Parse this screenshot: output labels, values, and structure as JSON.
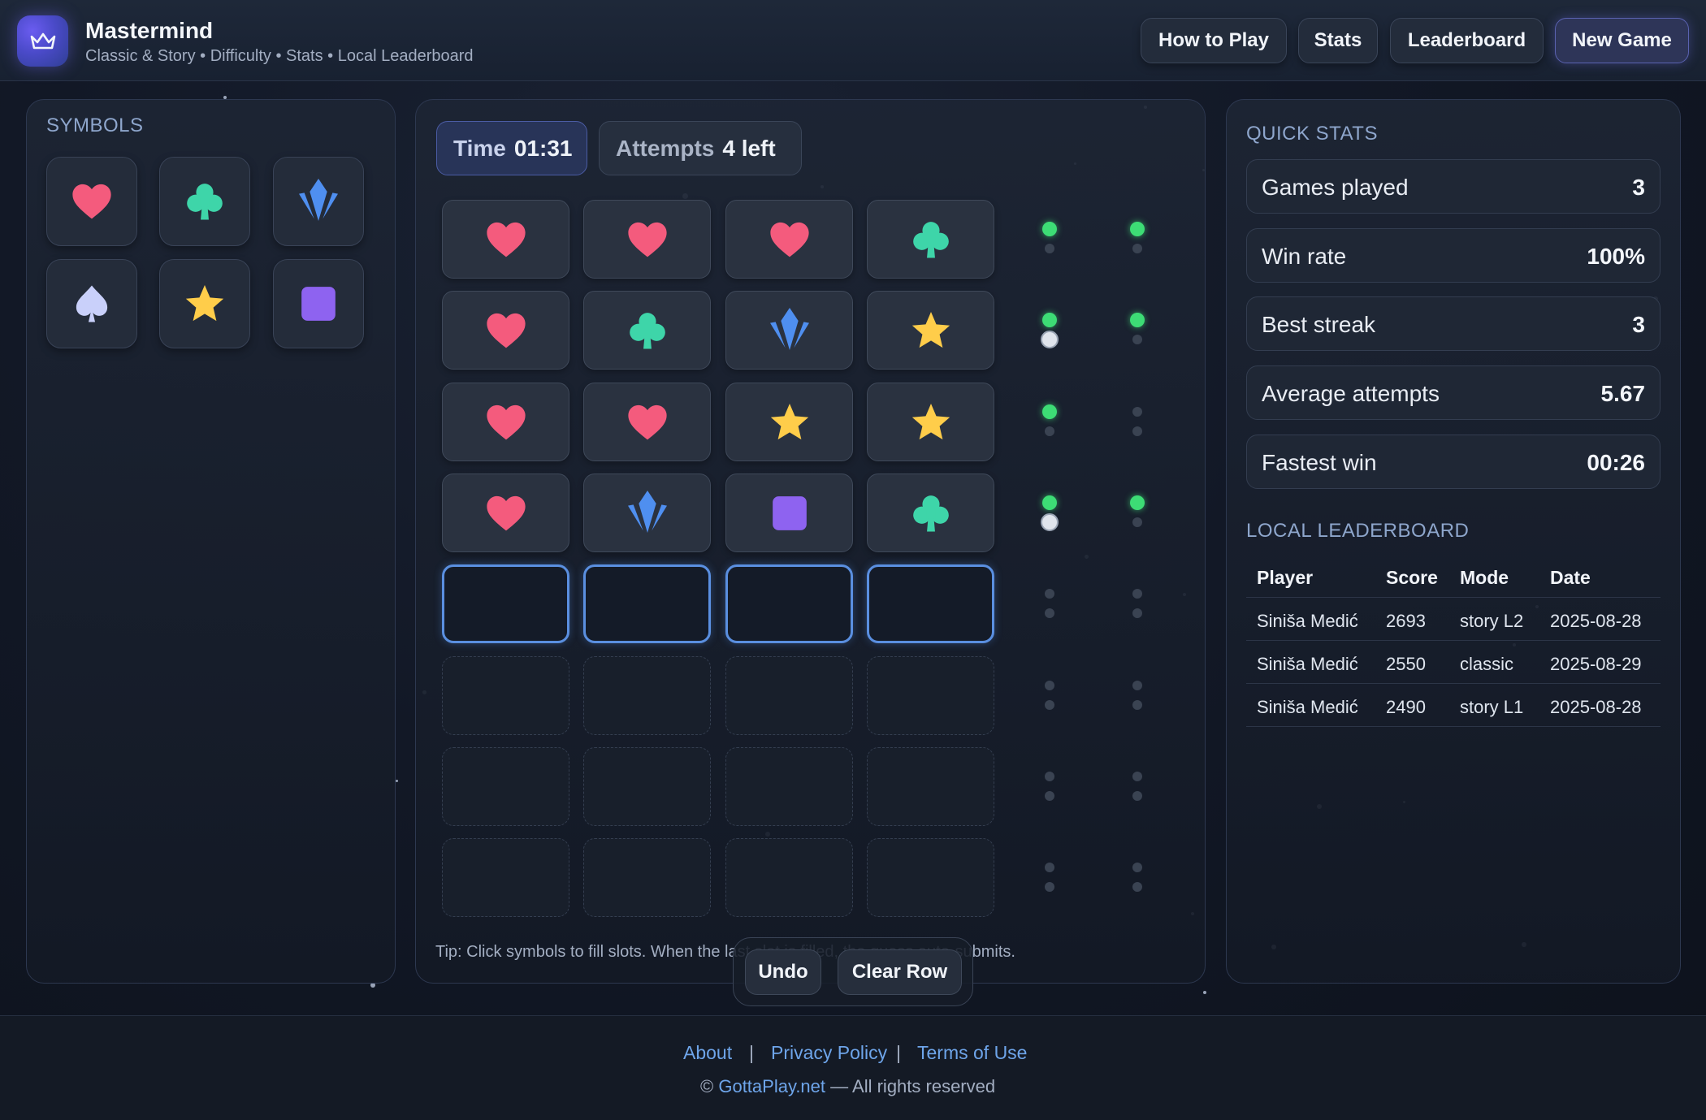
{
  "header": {
    "title": "Mastermind",
    "subtitle": "Classic & Story • Difficulty • Stats • Local Leaderboard",
    "buttons": {
      "how_to_play": "How to Play",
      "stats": "Stats",
      "leaderboard": "Leaderboard",
      "new_game": "New Game"
    }
  },
  "symbols_panel": {
    "label": "SYMBOLS",
    "symbols": [
      "heart-icon",
      "club-icon",
      "crystal-icon",
      "spade-icon",
      "star-icon",
      "square-icon"
    ]
  },
  "board": {
    "time_label": "Time",
    "time_value": "01:31",
    "attempts_label": "Attempts",
    "attempts_value": "4 left",
    "guesses": [
      {
        "symbols": [
          "heart",
          "heart",
          "heart",
          "club"
        ],
        "exact": 2,
        "partial": 0
      },
      {
        "symbols": [
          "heart",
          "club",
          "crystal",
          "star"
        ],
        "exact": 2,
        "partial": 1
      },
      {
        "symbols": [
          "heart",
          "heart",
          "star",
          "star"
        ],
        "exact": 1,
        "partial": 0
      },
      {
        "symbols": [
          "heart",
          "crystal",
          "square",
          "club"
        ],
        "exact": 2,
        "partial": 1
      }
    ],
    "total_rows": 8,
    "tip": "Tip: Click symbols to fill slots. When the last slot is filled, the guess auto-submits.",
    "undo_label": "Undo",
    "clear_row_label": "Clear Row"
  },
  "colors": {
    "heart": "#f45b7d",
    "club": "#3ed5a9",
    "crystal": "#4f8ff0",
    "spade": "#c9d0fa",
    "star": "#ffcd4a",
    "square": "#8e63f0",
    "exact_peg": "#3ddc75",
    "partial_peg": "#e0e4ec"
  },
  "quick_stats": {
    "label": "QUICK STATS",
    "rows": [
      {
        "key": "Games played",
        "value": "3"
      },
      {
        "key": "Win rate",
        "value": "100%"
      },
      {
        "key": "Best streak",
        "value": "3"
      },
      {
        "key": "Average attempts",
        "value": "5.67"
      },
      {
        "key": "Fastest win",
        "value": "00:26"
      }
    ]
  },
  "leaderboard": {
    "label": "LOCAL LEADERBOARD",
    "columns": [
      "Player",
      "Score",
      "Mode",
      "Date"
    ],
    "rows": [
      [
        "Siniša Medić",
        "2693",
        "story L2",
        "2025-08-28"
      ],
      [
        "Siniša Medić",
        "2550",
        "classic",
        "2025-08-29"
      ],
      [
        "Siniša Medić",
        "2490",
        "story L1",
        "2025-08-28"
      ]
    ]
  },
  "footer": {
    "about": "About",
    "privacy": "Privacy Policy",
    "terms": "Terms of Use",
    "copy_prefix": "©",
    "copy_site": "GottaPlay.net",
    "copy_suffix": "— All rights reserved",
    "sep": "|"
  }
}
